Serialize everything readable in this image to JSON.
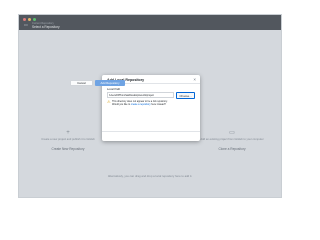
{
  "titlebar": {
    "label": "Current Repository",
    "value": "Select a Repository"
  },
  "welcome": {
    "create": {
      "text": "Create a new project and publish it to GitHub",
      "button": "Create New Repository"
    },
    "add": {
      "text": "Add an existing project from GitHub to your computer",
      "button": "Clone a Repository"
    },
    "drag_text": "Alternatively, you can drag and drop a local repository here to add it."
  },
  "dialog": {
    "title": "Add Local Repository",
    "close": "×",
    "path_label": "Local Path",
    "path_value": "/Users/FPPonchak/Desktop/wrenbitproject",
    "choose_button": "Choose...",
    "warning_line1": "This directory does not appear to be a Git repository.",
    "warning_line2_prefix": "Would you like to ",
    "warning_link": "create a repository",
    "warning_line2_suffix": " here instead?",
    "cancel_button": "Cancel",
    "add_button": "Add Repository"
  },
  "colors": {
    "titlebar": "#24292e",
    "accent": "#0366d6",
    "warning": "#d99e0b",
    "primary_disabled": "#6fa3e3"
  }
}
